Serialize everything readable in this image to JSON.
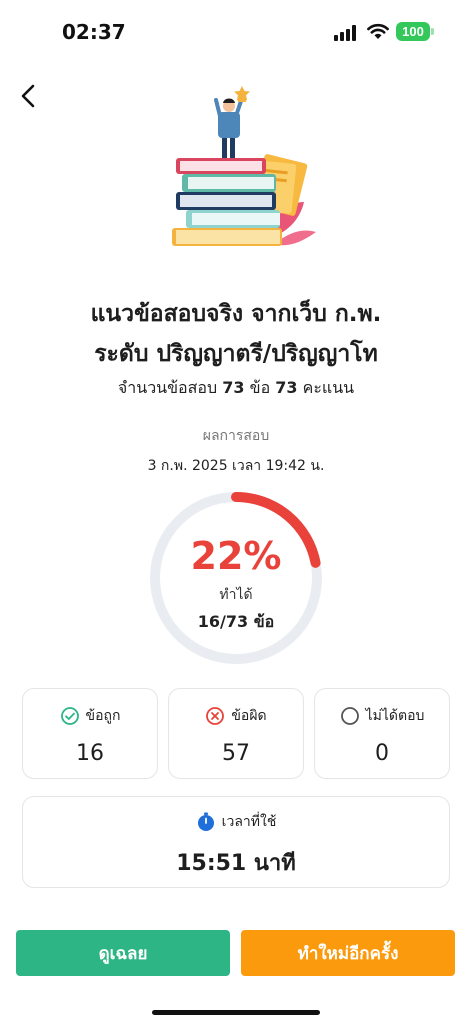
{
  "status_bar": {
    "time": "02:37",
    "battery": "100"
  },
  "exam": {
    "title_line1": "แนวข้อสอบจริง จากเว็บ ก.พ.",
    "title_line2": "ระดับ ปริญญาตรี/ปริญญาโท",
    "subtitle_prefix": "จำนวนข้อสอบ ",
    "question_count": "73",
    "subtitle_mid": " ข้อ ",
    "score_total": "73",
    "subtitle_suffix": " คะแนน"
  },
  "result": {
    "label": "ผลการสอบ",
    "datetime": "3 ก.พ. 2025 เวลา 19:42 น.",
    "percent_text": "22%",
    "percent_value": 0.22,
    "done_label": "ทำได้",
    "count_text": "16/73 ข้อ"
  },
  "stats": {
    "correct": {
      "label": "ข้อถูก",
      "value": "16",
      "icon": "check-circle-icon",
      "color": "#2db586"
    },
    "wrong": {
      "label": "ข้อผิด",
      "value": "57",
      "icon": "x-circle-icon",
      "color": "#e8423a"
    },
    "unanswered": {
      "label": "ไม่ได้ตอบ",
      "value": "0",
      "icon": "empty-circle-icon",
      "color": "#555555"
    }
  },
  "time_used": {
    "label": "เวลาที่ใช้",
    "value": "15:51 นาที",
    "icon": "stopwatch-icon"
  },
  "buttons": {
    "view_answers": "ดูเฉลย",
    "retry": "ทำใหม่อีกครั้ง"
  },
  "colors": {
    "accent_red": "#e8423a",
    "green": "#2db586",
    "orange": "#fb9a0c",
    "ring_track": "#e9edf2"
  }
}
